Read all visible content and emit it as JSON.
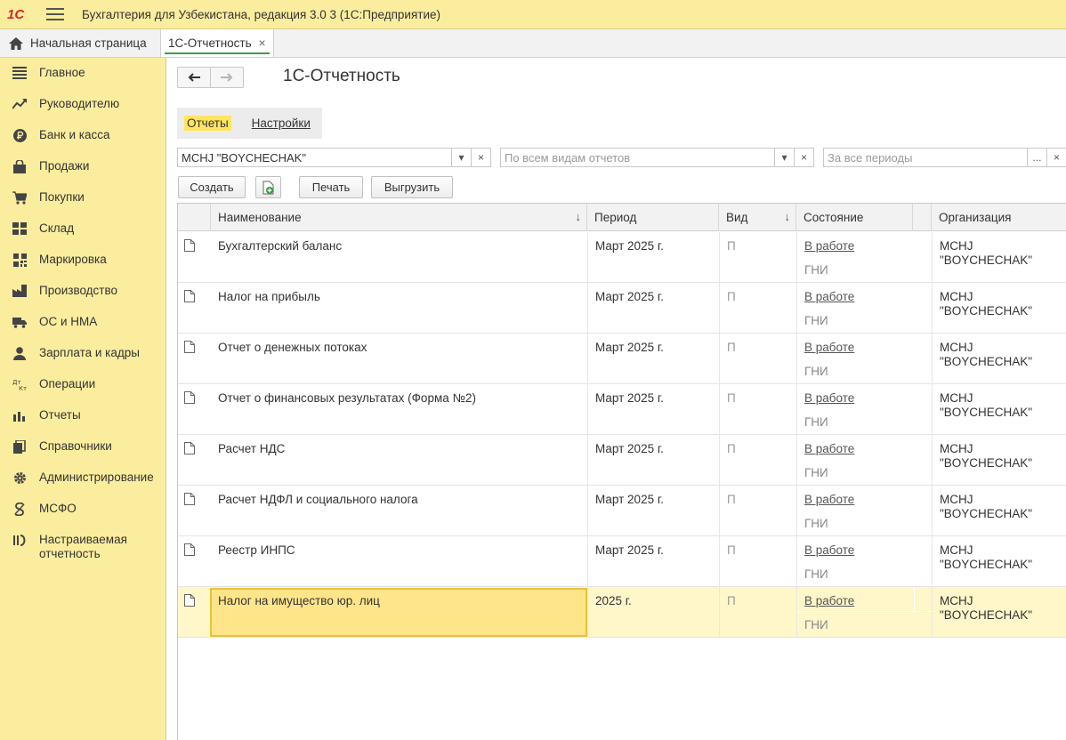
{
  "app": {
    "logo": "1С",
    "title": "Бухгалтерия для Узбекистана, редакция 3.0 3   (1С:Предприятие)"
  },
  "tabs": {
    "home_label": "Начальная страница",
    "active_label": "1С-Отчетность",
    "close_glyph": "×"
  },
  "sidebar": {
    "items": [
      {
        "label": "Главное",
        "icon": "menu-icon"
      },
      {
        "label": "Руководителю",
        "icon": "trend-icon"
      },
      {
        "label": "Банк и касса",
        "icon": "ruble-coin-icon"
      },
      {
        "label": "Продажи",
        "icon": "shopping-bag-icon"
      },
      {
        "label": "Покупки",
        "icon": "cart-icon"
      },
      {
        "label": "Склад",
        "icon": "warehouse-icon"
      },
      {
        "label": "Маркировка",
        "icon": "qr-code-icon"
      },
      {
        "label": "Производство",
        "icon": "factory-icon"
      },
      {
        "label": "ОС и НМА",
        "icon": "truck-icon"
      },
      {
        "label": "Зарплата и кадры",
        "icon": "person-icon"
      },
      {
        "label": "Операции",
        "icon": "dt-kt-icon"
      },
      {
        "label": "Отчеты",
        "icon": "bar-chart-icon"
      },
      {
        "label": "Справочники",
        "icon": "books-icon"
      },
      {
        "label": "Администрирование",
        "icon": "gear-icon"
      },
      {
        "label": "МСФО",
        "icon": "ifrs-icon"
      },
      {
        "label": "Настраиваемая отчетность",
        "icon": "custom-report-icon"
      }
    ]
  },
  "page": {
    "title": "1С-Отчетность",
    "subtabs": {
      "reports": "Отчеты",
      "settings": "Настройки"
    }
  },
  "filters": {
    "organization": "MCHJ \"BOYCHECHAK\"",
    "report_kind_placeholder": "По всем видам отчетов",
    "period_placeholder": "За все периоды",
    "dropdown_glyph": "▾",
    "clear_glyph": "×",
    "choose_glyph": "..."
  },
  "toolbar": {
    "create": "Создать",
    "print": "Печать",
    "export": "Выгрузить"
  },
  "table": {
    "columns": {
      "name": "Наименование",
      "period": "Период",
      "kind": "Вид",
      "state": "Состояние",
      "organization": "Организация",
      "sort_glyph": "↓"
    },
    "rows": [
      {
        "name": "Бухгалтерский баланс",
        "period": "Март 2025 г.",
        "kind": "П",
        "state": "В работе",
        "recipient": "ГНИ",
        "org_line1": "MCHJ",
        "org_line2": "\"BOYCHECHAK\""
      },
      {
        "name": "Налог на прибыль",
        "period": "Март 2025 г.",
        "kind": "П",
        "state": "В работе",
        "recipient": "ГНИ",
        "org_line1": "MCHJ",
        "org_line2": "\"BOYCHECHAK\""
      },
      {
        "name": "Отчет о денежных потоках",
        "period": "Март 2025 г.",
        "kind": "П",
        "state": "В работе",
        "recipient": "ГНИ",
        "org_line1": "MCHJ",
        "org_line2": "\"BOYCHECHAK\""
      },
      {
        "name": "Отчет о финансовых результатах (Форма №2)",
        "period": "Март 2025 г.",
        "kind": "П",
        "state": "В работе",
        "recipient": "ГНИ",
        "org_line1": "MCHJ",
        "org_line2": "\"BOYCHECHAK\""
      },
      {
        "name": "Расчет НДС",
        "period": "Март 2025 г.",
        "kind": "П",
        "state": "В работе",
        "recipient": "ГНИ",
        "org_line1": "MCHJ",
        "org_line2": "\"BOYCHECHAK\""
      },
      {
        "name": "Расчет НДФЛ и социального налога",
        "period": "Март 2025 г.",
        "kind": "П",
        "state": "В работе",
        "recipient": "ГНИ",
        "org_line1": "MCHJ",
        "org_line2": "\"BOYCHECHAK\""
      },
      {
        "name": "Реестр ИНПС",
        "period": "Март 2025 г.",
        "kind": "П",
        "state": "В работе",
        "recipient": "ГНИ",
        "org_line1": "MCHJ",
        "org_line2": "\"BOYCHECHAK\""
      },
      {
        "name": "Налог на имущество юр. лиц",
        "period": "2025 г.",
        "kind": "П",
        "state": "В работе",
        "recipient": "ГНИ",
        "org_line1": "MCHJ",
        "org_line2": "\"BOYCHECHAK\"",
        "selected": true
      }
    ]
  }
}
